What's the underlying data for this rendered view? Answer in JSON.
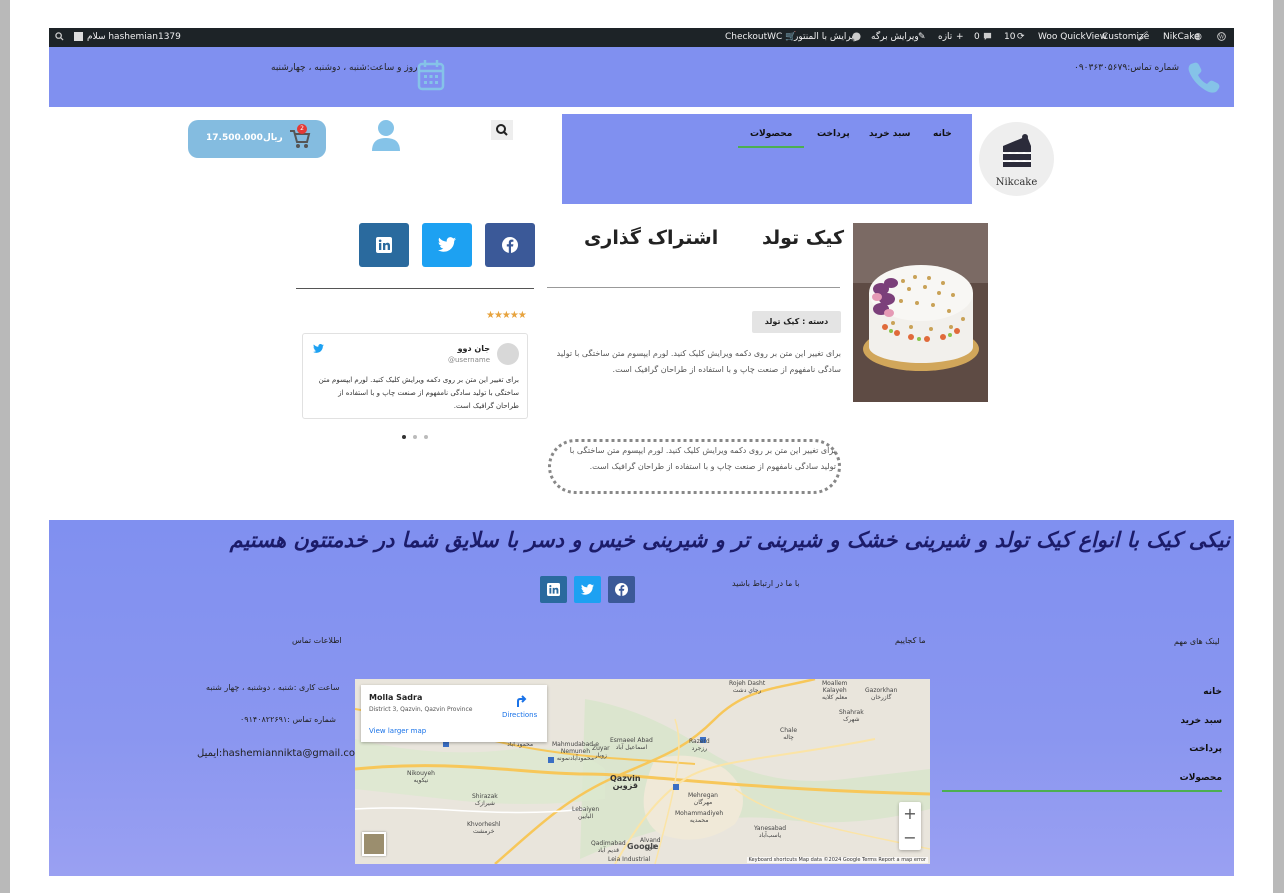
{
  "admin_bar": {
    "greeting": "سلام hashemian1379",
    "site_name": "NikCake",
    "customize": "Customize",
    "woo_quickview": "Woo QuickView",
    "updates_count": "10",
    "comments_count": "0",
    "new_label": "تازه",
    "edit_page": "ویرایش برگه",
    "edit_elementor": "ویرایش با المنتور",
    "checkoutwc": "CheckoutWC"
  },
  "top_bar": {
    "phone": "شماره تماس:۰۹۰۳۶۳۰۵۶۷۹",
    "hours": "روز و ساعت:شنبه ، دوشنبه ، چهارشنبه",
    "bg_color": "#8090f0"
  },
  "header": {
    "nav": [
      "خانه",
      "سبد خرید",
      "پرداخت",
      "محصولات"
    ],
    "logo_text": "Nikcake",
    "cart_price": "17.500.000ریال",
    "cart_count": "2"
  },
  "product": {
    "title": "کیک تولد",
    "share_title": "اشتراک گذاری",
    "category": "دسته : کیک تولد",
    "description": "برای تغییر این متن بر روی دکمه ویرایش کلیک کنید. لورم ایپسوم متن ساختگی با تولید سادگی نامفهوم از صنعت چاپ و با استفاده از طراحان گرافیک است."
  },
  "testimonial": {
    "stars": "★★★★★",
    "name": "جان دوو",
    "handle": "@username",
    "text": "برای تغییر این متن بر روی دکمه ویرایش کلیک کنید. لورم ایپسوم متن ساختگی با تولید سادگی نامفهوم از صنعت چاپ و با استفاده از طراحان گرافیک است."
  },
  "dotted_text": "برای تغییر این متن بر روی دکمه ویرایش کلیک کنید. لورم ایپسوم متن ساختگی با تولید سادگی نامفهوم از صنعت چاپ و با استفاده از طراحان گرافیک است.",
  "footer": {
    "slogan": "نیکی کیک با انواع کیک تولد و شیرینی خشک و شیرینی تر و شیرینی خیس و دسر  با سلایق شما در خدمتتون هستیم",
    "contact_us": "با ما در ارتباط باشید",
    "links_title": "لینک های مهم",
    "where_title": "ما کجاییم",
    "info_title": "اطلاعات تماس",
    "links": [
      "خانه",
      "سبد خرید",
      "پرداخت",
      "محصولات"
    ],
    "hours": "ساعت کاری :شنبه ، دوشنبه ، چهار شنبه",
    "phone": "شماره تماس :۰۹۱۴۰۸۲۲۶۹۱",
    "email": "hashemiannikta@gmail.com:ایمیل"
  },
  "map": {
    "place": "Molla Sadra",
    "address": "District 3, Qazvin, Qazvin Province",
    "larger_map": "View larger map",
    "directions": "Directions",
    "zoom_in": "+",
    "zoom_out": "−",
    "attribution": "Keyboard shortcuts   Map data ©2024 Google   Terms   Report a map error",
    "labels": [
      {
        "text": "Rojeh Dasht\nرجاي دشت",
        "bold": false
      },
      {
        "text": "Moallem\nKalayeh\nمعلم کلایه",
        "bold": false
      },
      {
        "text": "Gazorkhan\nگازرخان",
        "bold": false
      },
      {
        "text": "Shahrak\nشهرک",
        "bold": false
      },
      {
        "text": "Chale\nچاله",
        "bold": false
      },
      {
        "text": "Esmaeel Abad\nاسماعیل آباد",
        "bold": false
      },
      {
        "text": "Razerd\nرزجرد",
        "bold": false
      },
      {
        "text": "Zuyar\nزویار",
        "bold": false
      },
      {
        "text": "Qazvin\nقزوین",
        "bold": true
      },
      {
        "text": "Mahmudabad-e\nNemuneh\nمحمودآبادنمونه",
        "bold": false
      },
      {
        "text": "Nikouyeh\nنیکویه",
        "bold": false
      },
      {
        "text": "Shirazak\nشیرازک",
        "bold": false
      },
      {
        "text": "Lebaiyen\nالبایین",
        "bold": false
      },
      {
        "text": "Mehregan\nمهرگان",
        "bold": false
      },
      {
        "text": "Mohammadiyeh\nمحمدیه",
        "bold": false
      },
      {
        "text": "Khvorheshl\nخرمشت",
        "bold": false
      },
      {
        "text": "Yanesabad\nیاسب‌آباد",
        "bold": false
      },
      {
        "text": "Qadimabad\nقدیم آباد",
        "bold": false
      },
      {
        "text": "Alvand\nالوند",
        "bold": false
      },
      {
        "text": "Leia Industrial",
        "bold": false
      },
      {
        "text": "Judabad-e\nKhani\nمحمود آباد",
        "bold": false
      },
      {
        "text": "Google",
        "bold": true
      }
    ]
  },
  "colors": {
    "facebook": "#3b5998",
    "twitter": "#1da1f2",
    "linkedin": "#0a66c2",
    "accent_green": "#4caf50",
    "cart_button": "#84bce0"
  }
}
